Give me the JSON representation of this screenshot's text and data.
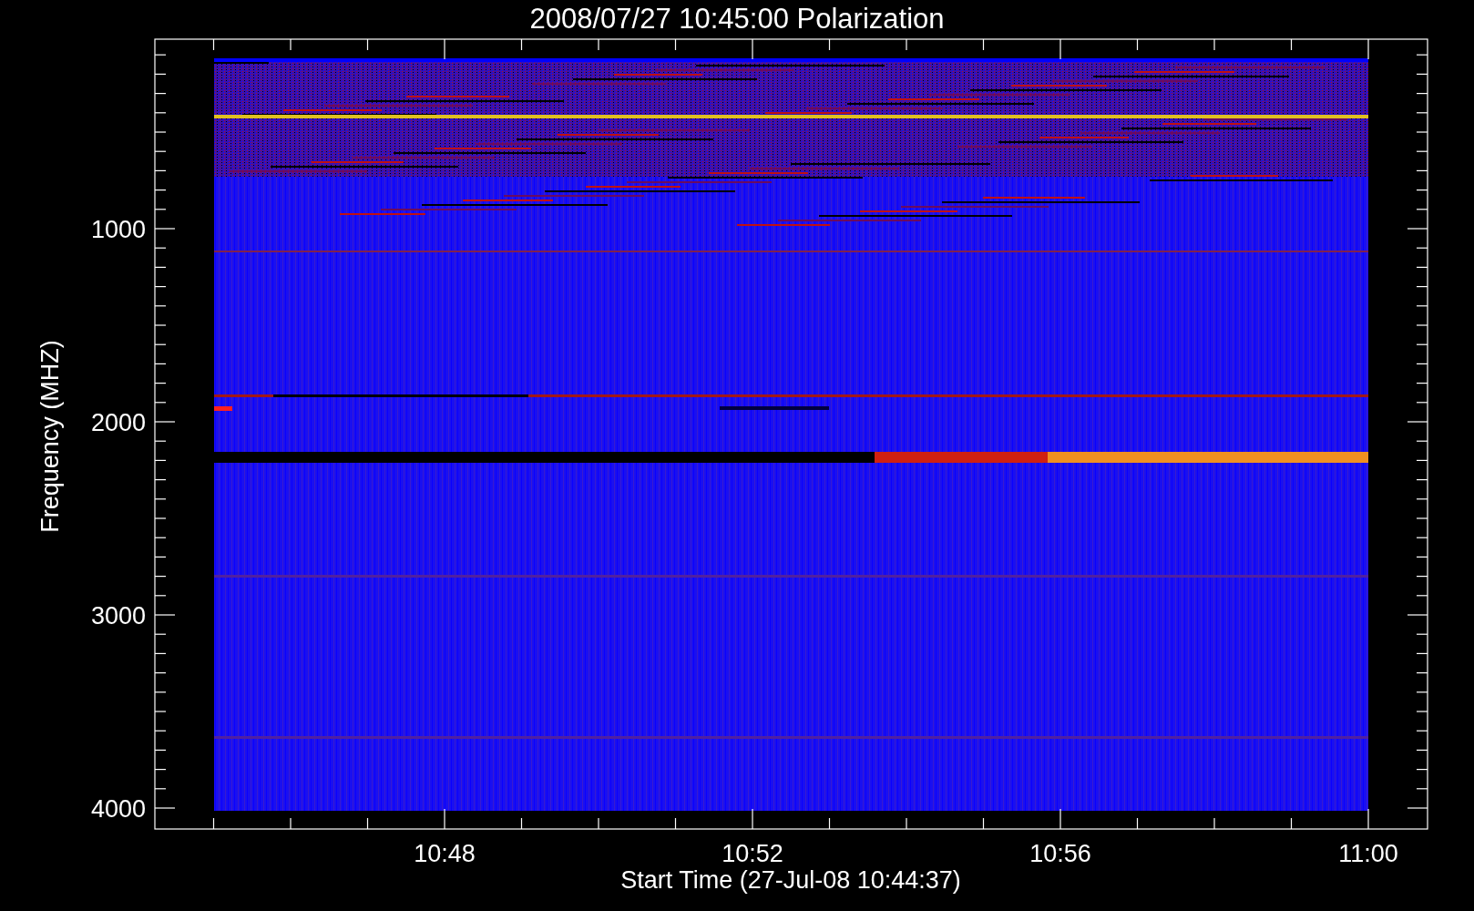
{
  "title": "2008/07/27 10:45:00 Polarization",
  "y_axis": {
    "label": "Frequency (MHZ)",
    "ticks": [
      "1000",
      "2000",
      "3000",
      "4000"
    ]
  },
  "x_axis": {
    "label": "Start Time (27-Jul-08 10:44:37)",
    "ticks": [
      "10:48",
      "10:52",
      "10:56",
      "11:00"
    ]
  }
}
